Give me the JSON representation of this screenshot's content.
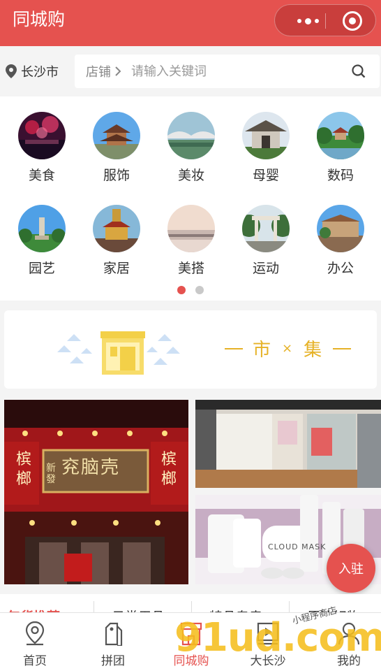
{
  "app": {
    "title": "同城购"
  },
  "search": {
    "city": "长沙市",
    "scope": "店铺",
    "placeholder": "请输入关键词"
  },
  "categories": [
    {
      "label": "美食",
      "icon": "night-city-photo"
    },
    {
      "label": "服饰",
      "icon": "pavilion-photo"
    },
    {
      "label": "美妆",
      "icon": "bridge-photo"
    },
    {
      "label": "母婴",
      "icon": "gate-photo"
    },
    {
      "label": "数码",
      "icon": "park-pavilion-photo"
    },
    {
      "label": "园艺",
      "icon": "monument-photo"
    },
    {
      "label": "家居",
      "icon": "temple-photo"
    },
    {
      "label": "美搭",
      "icon": "river-photo"
    },
    {
      "label": "运动",
      "icon": "archway-photo"
    },
    {
      "label": "办公",
      "icon": "building-photo"
    }
  ],
  "pager": {
    "count": 2,
    "active": 0
  },
  "banner": {
    "text_left": "市",
    "text_sep": "×",
    "text_right": "集"
  },
  "promos": {
    "shop_sign": "兖脑壳",
    "shop_prefix": "新 發",
    "side_left": "槟榔",
    "side_right": "槟榔",
    "product_label": "CLOUD MASK"
  },
  "join_button": "入驻",
  "category_tabs": [
    "年货推荐",
    "日常用品",
    "特品专卖",
    "周边好物"
  ],
  "nav": [
    {
      "label": "首页",
      "icon": "location-pin-icon"
    },
    {
      "label": "拼团",
      "icon": "tag-icon"
    },
    {
      "label": "同城购",
      "icon": "shop-icon",
      "active": true
    },
    {
      "label": "大长沙",
      "icon": "video-icon"
    },
    {
      "label": "我的",
      "icon": "user-icon"
    }
  ],
  "watermark": {
    "main": "91ud.com",
    "sub": "小程序商店"
  },
  "colors": {
    "brand": "#e5524f",
    "banner_accent": "#e6b227"
  }
}
